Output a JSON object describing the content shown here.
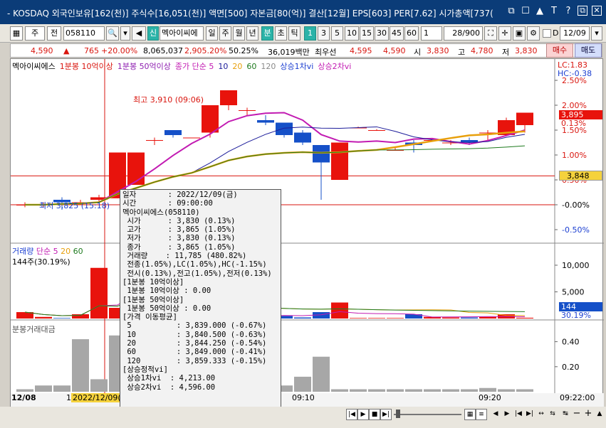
{
  "titlebar": {
    "title": "- KOSDAQ 외국인보유[162(천)] 주식수[16,051(천)] 액면[500] 자본금[80(억)] 결산[12월] EPS[603] PER[7.62] 시가총액[737(",
    "buttons": [
      "⧉",
      "☐",
      "▲",
      "T",
      "?",
      "⧉",
      "✕"
    ]
  },
  "toolbar": {
    "market": "주",
    "all_label": "전",
    "code": "058110",
    "new_badge": "신",
    "stock_name": "멕아이씨에",
    "periods": [
      "일",
      "주",
      "월",
      "년",
      "분",
      "초",
      "틱"
    ],
    "active_period": "분",
    "intervals": [
      "1",
      "3",
      "5",
      "10",
      "15",
      "30",
      "45",
      "60"
    ],
    "active_interval": "1",
    "count_select": "1",
    "page_counter": "28/900",
    "date_checkbox_label": "D",
    "date_value": "12/09"
  },
  "quote": {
    "price": "4,590",
    "arrow": "▲",
    "change": "765",
    "change_pct": "+20.00%",
    "volume": "8,065,037",
    "volume_pct": "2,905.20%",
    "ratio": "50.25%",
    "amount": "36,019백만",
    "lowest_label": "최우선",
    "best_ask": "4,595",
    "best_bid": "4,590",
    "open_label": "시",
    "open": "3,830",
    "high_label": "고",
    "high": "4,780",
    "low_label": "저",
    "low": "3,830",
    "buy_label": "매수",
    "sell_label": "매도"
  },
  "legend_main": {
    "items": [
      {
        "label": "멕아이씨에스",
        "color": "#000000"
      },
      {
        "label": "1분봉 10억이상",
        "color": "#d9160f"
      },
      {
        "label": "1분봉 50억이상",
        "color": "#8e1fb0"
      },
      {
        "label": "종가 단순 5",
        "color": "#c21bb2"
      },
      {
        "label": "10",
        "color": "#1c1c9a"
      },
      {
        "label": "20",
        "color": "#e8a00c"
      },
      {
        "label": "60",
        "color": "#1e7a1e"
      },
      {
        "label": "120",
        "color": "#8a8a8a"
      },
      {
        "label": "상승1차vi",
        "color": "#1c3fd1"
      },
      {
        "label": "상승2차vi",
        "color": "#c21bb2"
      }
    ]
  },
  "chart_labels": {
    "lc": "LC:1.83",
    "hc": "HC:-0.38",
    "high_marker": "최고 3,910 (09:06)",
    "low_marker": "최저 3,825 (15:18)",
    "current_price_badge": "3,895",
    "current_pct_badge": "0.13%",
    "ref_price_badge": "3,848",
    "volume_badge": "144",
    "volume_pct_badge": "30.19%"
  },
  "volume_legend": {
    "title": "거래량",
    "items": [
      {
        "label": "단순 5",
        "color": "#c21bb2"
      },
      {
        "label": "20",
        "color": "#e8a00c"
      },
      {
        "label": "60",
        "color": "#1e7a1e"
      }
    ],
    "sub": "144주(30.19%)"
  },
  "amount_legend": {
    "title": "분봉거래대금"
  },
  "x_labels": [
    "12/08",
    "1",
    "2022/12/09(",
    "09:10",
    "09:20",
    "09:22:00"
  ],
  "tooltip": {
    "lines": [
      "일자       : 2022/12/09(금)",
      "시간       : 09:00:00",
      "멕아이씨에스(058110)",
      " 시가      : 3,830 (0.13%)",
      " 고가      : 3,865 (1.05%)",
      " 저가      : 3,830 (0.13%)",
      " 종가      : 3,865 (1.05%)",
      " 거래량    : 11,785 (480.82%)",
      " 전종(1.05%),LC(1.05%),HC(-1.15%)",
      " 전시(0.13%),전고(1.05%),전저(0.13%)",
      "[1분봉 10억이상]",
      " 1분봉 10억이상 : 0.00",
      "[1분봉 50억이상]",
      " 1분봉 50억이상 : 0.00",
      "[가격 이동평균]",
      " 5          : 3,839.000 (-0.67%)",
      " 10         : 3,840.500 (-0.63%)",
      " 20         : 3,844.250 (-0.54%)",
      " 60         : 3,849.000 (-0.41%)",
      " 120        : 3,859.333 (-0.15%)",
      "[상승정적vi]",
      " 상승1차vi  : 4,213.00",
      " 상승2차vi  : 4,596.00"
    ]
  },
  "chart_data": [
    {
      "type": "candlestick",
      "title": "",
      "y_ticks": [
        "2.50%",
        "2.00%",
        "1.50%",
        "1.00%",
        "0.50%",
        "-0.00%",
        "-0.50%"
      ],
      "ylim_pct": [
        -0.5,
        2.5
      ],
      "candles_pct": [
        {
          "o": 0.0,
          "h": 0.05,
          "l": -0.05,
          "c": 0.0
        },
        {
          "o": 0.0,
          "h": 0.05,
          "l": -0.05,
          "c": 0.0
        },
        {
          "o": 0.1,
          "h": 0.15,
          "l": -0.1,
          "c": 0.05
        },
        {
          "o": 0.05,
          "h": 0.1,
          "l": 0.0,
          "c": 0.05
        },
        {
          "o": 0.1,
          "h": 0.2,
          "l": 0.05,
          "c": 0.15
        },
        {
          "o": 0.13,
          "h": 1.05,
          "l": 0.13,
          "c": 1.05
        },
        {
          "o": 0.4,
          "h": 1.05,
          "l": 0.4,
          "c": 1.05
        },
        {
          "o": 1.3,
          "h": 1.35,
          "l": 1.2,
          "c": 1.3
        },
        {
          "o": 1.5,
          "h": 1.5,
          "l": 1.35,
          "c": 1.4
        },
        {
          "o": 1.35,
          "h": 1.35,
          "l": 1.35,
          "c": 1.35
        },
        {
          "o": 1.45,
          "h": 2.0,
          "l": 1.35,
          "c": 2.0
        },
        {
          "o": 2.0,
          "h": 2.3,
          "l": 1.9,
          "c": 2.3
        },
        {
          "o": 1.9,
          "h": 1.95,
          "l": 1.8,
          "c": 1.9
        },
        {
          "o": 1.7,
          "h": 1.8,
          "l": 1.6,
          "c": 1.65
        },
        {
          "o": 1.65,
          "h": 1.65,
          "l": 1.35,
          "c": 1.4
        },
        {
          "o": 1.45,
          "h": 1.5,
          "l": 1.2,
          "c": 1.25
        },
        {
          "o": 1.2,
          "h": 1.2,
          "l": 0.1,
          "c": 0.85
        },
        {
          "o": 0.5,
          "h": 1.25,
          "l": 0.5,
          "c": 1.25
        },
        {
          "o": 1.55,
          "h": 1.57,
          "l": 1.55,
          "c": 1.55
        },
        {
          "o": 1.5,
          "h": 1.52,
          "l": 1.5,
          "c": 1.5
        },
        {
          "o": 1.1,
          "h": 1.15,
          "l": 1.1,
          "c": 1.1
        },
        {
          "o": 1.25,
          "h": 1.3,
          "l": 1.05,
          "c": 1.2
        },
        {
          "o": 1.3,
          "h": 1.3,
          "l": 1.3,
          "c": 1.3
        },
        {
          "o": 1.25,
          "h": 1.3,
          "l": 1.2,
          "c": 1.25
        },
        {
          "o": 1.3,
          "h": 1.35,
          "l": 1.2,
          "c": 1.25
        },
        {
          "o": 1.45,
          "h": 1.5,
          "l": 1.3,
          "c": 1.45
        },
        {
          "o": 1.4,
          "h": 1.75,
          "l": 1.4,
          "c": 1.7
        },
        {
          "o": 1.6,
          "h": 1.85,
          "l": 1.45,
          "c": 1.85
        }
      ]
    },
    {
      "type": "bar",
      "title": "거래량",
      "y_ticks": [
        "10,000",
        "5,000"
      ],
      "values": [
        1200,
        300,
        100,
        800,
        9500,
        2000,
        10000,
        1000,
        500,
        200,
        300,
        400,
        100,
        1500,
        500,
        200,
        1200,
        3000,
        100,
        100,
        100,
        800,
        300,
        200,
        200,
        300,
        800,
        144
      ],
      "colors_up": "#e8130c",
      "colors_down": "#1550c8"
    },
    {
      "type": "bar",
      "title": "분봉거래대금",
      "y_ticks": [
        "0.40",
        "0.20"
      ],
      "values": [
        0.02,
        0.05,
        0.05,
        0.42,
        0.1,
        0.45,
        0.05,
        0.02,
        0.02,
        0.02,
        0.02,
        0.02,
        0.02,
        0.02,
        0.05,
        0.12,
        0.28,
        0.02,
        0.02,
        0.02,
        0.02,
        0.02,
        0.02,
        0.02,
        0.02,
        0.03,
        0.02,
        0.02
      ]
    }
  ]
}
